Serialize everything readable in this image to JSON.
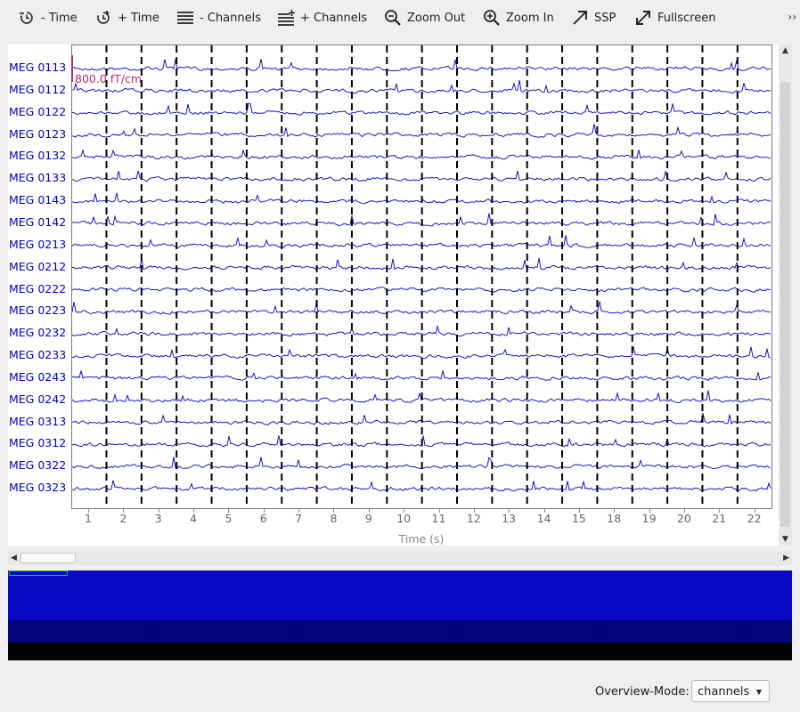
{
  "toolbar": {
    "buttons": [
      {
        "label": "- Time",
        "icon": "clock-minus-icon"
      },
      {
        "label": "+ Time",
        "icon": "clock-plus-icon"
      },
      {
        "label": "- Channels",
        "icon": "channels-minus-icon"
      },
      {
        "label": "+ Channels",
        "icon": "channels-plus-icon"
      },
      {
        "label": "Zoom Out",
        "icon": "zoom-out-icon"
      },
      {
        "label": "Zoom In",
        "icon": "zoom-in-icon"
      },
      {
        "label": "SSP",
        "icon": "arrow-diagonal-icon"
      },
      {
        "label": "Fullscreen",
        "icon": "fullscreen-icon"
      }
    ],
    "overflow": "››"
  },
  "plot": {
    "channels": [
      "MEG 0113",
      "MEG 0112",
      "MEG 0122",
      "MEG 0123",
      "MEG 0132",
      "MEG 0133",
      "MEG 0143",
      "MEG 0142",
      "MEG 0213",
      "MEG 0212",
      "MEG 0222",
      "MEG 0223",
      "MEG 0232",
      "MEG 0233",
      "MEG 0243",
      "MEG 0242",
      "MEG 0313",
      "MEG 0312",
      "MEG 0322",
      "MEG 0323"
    ],
    "scale_label": "800.0 fT/cm",
    "x_ticks": [
      "1",
      "2",
      "3",
      "4",
      "5",
      "6",
      "7",
      "8",
      "9",
      "10",
      "11",
      "12",
      "13",
      "14",
      "15",
      "18",
      "19",
      "20",
      "21",
      "22"
    ],
    "x_label": "Time (s)",
    "trace_color": "#0000c8",
    "event_line_color": "#000000"
  },
  "overview": {
    "mode_label": "Overview-Mode:",
    "mode_value": "channels",
    "colors": {
      "upper": "#0a0ad0",
      "middle": "#050580",
      "lower": "#000000"
    }
  }
}
